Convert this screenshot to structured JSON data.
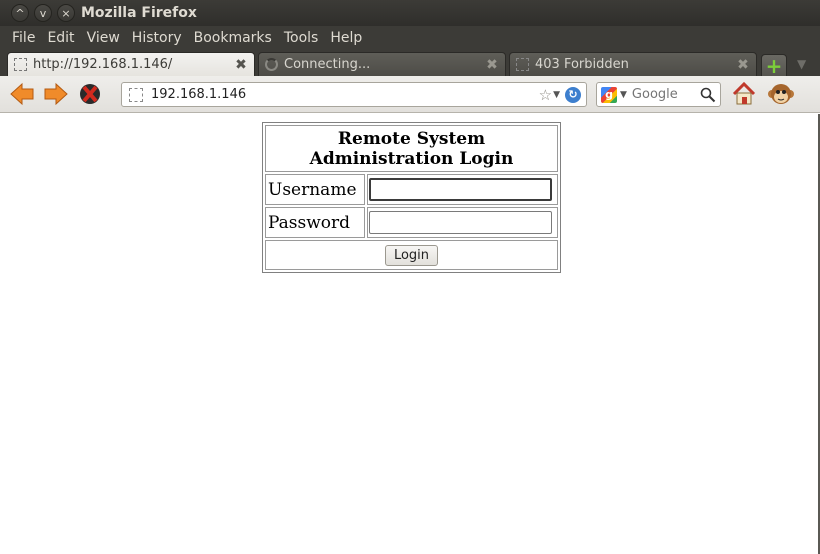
{
  "window": {
    "title": "Mozilla Firefox",
    "controls": [
      "^",
      "v",
      "×"
    ]
  },
  "menu": {
    "items": [
      "File",
      "Edit",
      "View",
      "History",
      "Bookmarks",
      "Tools",
      "Help"
    ]
  },
  "tabs": [
    {
      "title": "http://192.168.1.146/",
      "state": "active"
    },
    {
      "title": "Connecting...",
      "state": "loading"
    },
    {
      "title": "403 Forbidden",
      "state": "inactive"
    }
  ],
  "tab_close_glyph": "✖",
  "tablist_glyph": "▼",
  "newtab_glyph": "+",
  "navbar": {
    "url": "192.168.1.146",
    "search_placeholder": "Google",
    "search_engine_letter": "g"
  },
  "login_form": {
    "heading": "Remote System Administration Login",
    "username_label": "Username",
    "username_value": "",
    "password_label": "Password",
    "password_value": "",
    "submit_label": "Login"
  },
  "icons": {
    "back": "back-arrow-icon",
    "forward": "forward-arrow-icon",
    "stop": "stop-icon",
    "home": "home-icon",
    "addon": "monkey-addon-icon"
  },
  "colors": {
    "chrome_dark": "#3c3b37",
    "nav_arrow": "#f08b2a",
    "stop_red": "#d22a1e"
  }
}
